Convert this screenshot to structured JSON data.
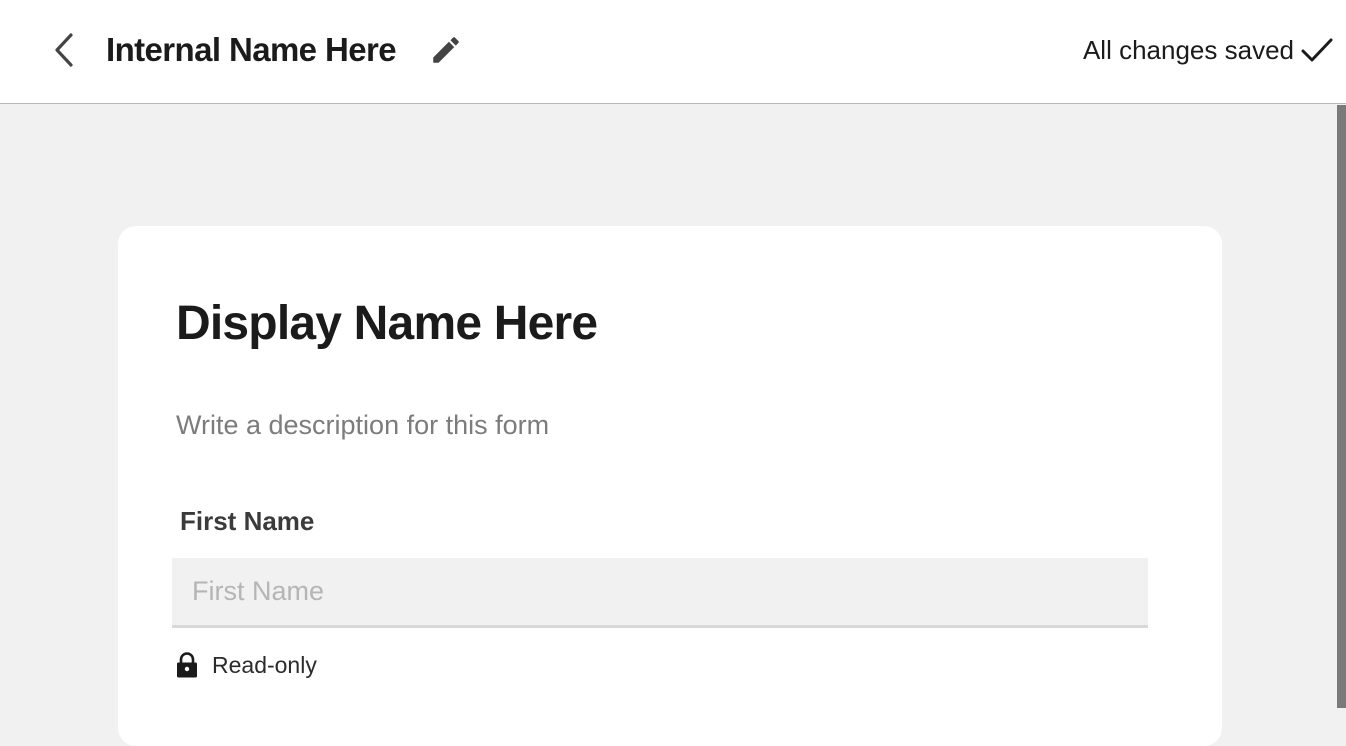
{
  "header": {
    "back_icon": "chevron-left-icon",
    "internal_name": "Internal Name Here",
    "edit_icon": "pencil-icon",
    "save_status": "All changes saved",
    "save_status_icon": "checkmark-icon"
  },
  "form": {
    "display_name": "Display Name Here",
    "description_placeholder": "Write a description for this form",
    "fields": [
      {
        "label": "First Name",
        "placeholder": "First Name",
        "value": "",
        "status_icon": "lock-icon",
        "status_text": "Read-only"
      }
    ]
  },
  "colors": {
    "page_background": "#f1f1f1",
    "card_background": "#ffffff",
    "text_primary": "#1b1b1b",
    "text_muted": "#7c7c7c",
    "input_background": "#f1f1f1",
    "placeholder": "#b5b5b5"
  }
}
